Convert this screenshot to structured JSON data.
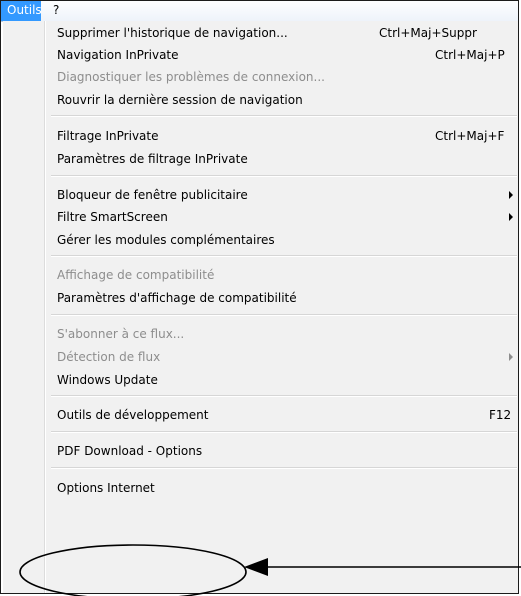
{
  "menubar": {
    "active_menu": "Outils",
    "help_menu": "?"
  },
  "menu": {
    "items": [
      {
        "label": "Supprimer l'historique de navigation...",
        "shortcut": "Ctrl+Maj+Suppr"
      },
      {
        "label": "Navigation InPrivate",
        "shortcut": "Ctrl+Maj+P"
      },
      {
        "label": "Diagnostiquer les problèmes de connexion..."
      },
      {
        "label": "Rouvrir la dernière session de navigation"
      },
      {
        "label": "Filtrage InPrivate",
        "shortcut": "Ctrl+Maj+F"
      },
      {
        "label": "Paramètres de filtrage InPrivate"
      },
      {
        "label": "Bloqueur de fenêtre publicitaire"
      },
      {
        "label": "Filtre SmartScreen"
      },
      {
        "label": "Gérer les modules complémentaires"
      },
      {
        "label": "Affichage de compatibilité"
      },
      {
        "label": "Paramètres d'affichage de compatibilité"
      },
      {
        "label": "S'abonner à ce flux..."
      },
      {
        "label": "Détection de flux"
      },
      {
        "label": "Windows Update"
      },
      {
        "label": "Outils de développement",
        "shortcut": "F12"
      },
      {
        "label": "PDF Download - Options"
      },
      {
        "label": "Options Internet"
      }
    ]
  },
  "colors": {
    "highlight": "#3399ff",
    "menu_background": "#f1f1f1",
    "disabled_text": "#8d8d8d",
    "annotation": "#000000"
  }
}
